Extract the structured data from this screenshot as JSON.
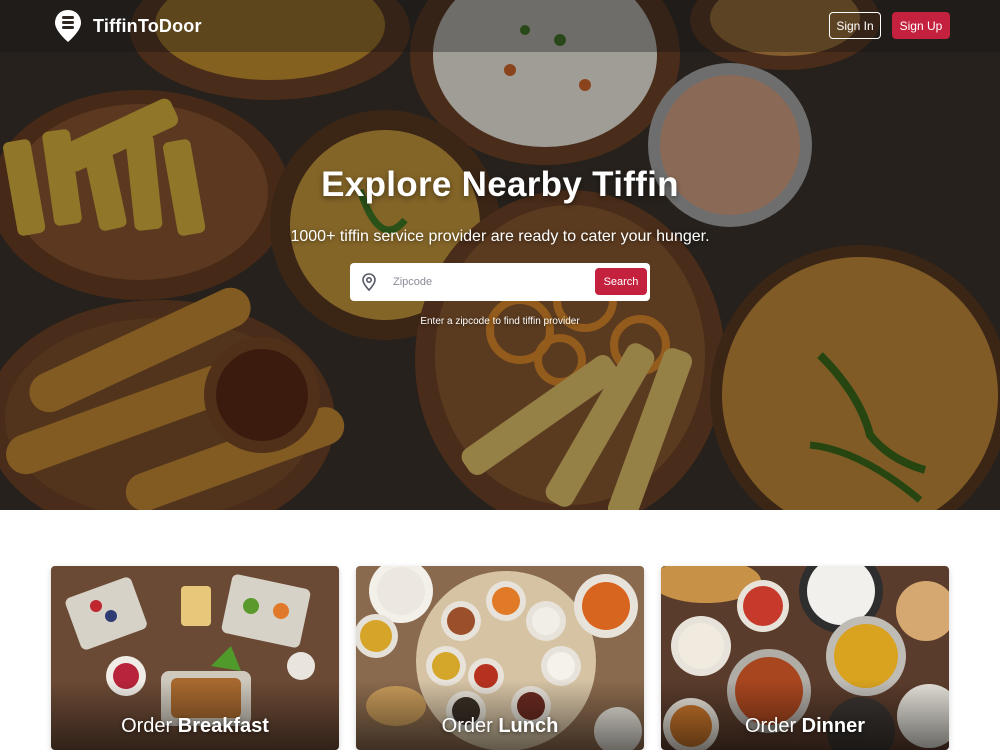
{
  "brand": {
    "name": "TiffinToDoor",
    "logo_icon": "tiffin-box-pin-icon"
  },
  "nav": {
    "signin_label": "Sign In",
    "signup_label": "Sign Up"
  },
  "hero": {
    "title": "Explore Nearby Tiffin",
    "subtitle": "1000+ tiffin service provider are ready to cater your hunger.",
    "search": {
      "placeholder": "Zipcode",
      "value": "",
      "button_label": "Search",
      "icon": "location-pin-icon"
    },
    "hint": "Enter a zipcode to find tiffin provider"
  },
  "meals": [
    {
      "prefix": "Order",
      "name": "Breakfast"
    },
    {
      "prefix": "Order",
      "name": "Lunch"
    },
    {
      "prefix": "Order",
      "name": "Dinner"
    }
  ],
  "colors": {
    "accent": "#c4213f",
    "text_on_dark": "#ffffff"
  }
}
